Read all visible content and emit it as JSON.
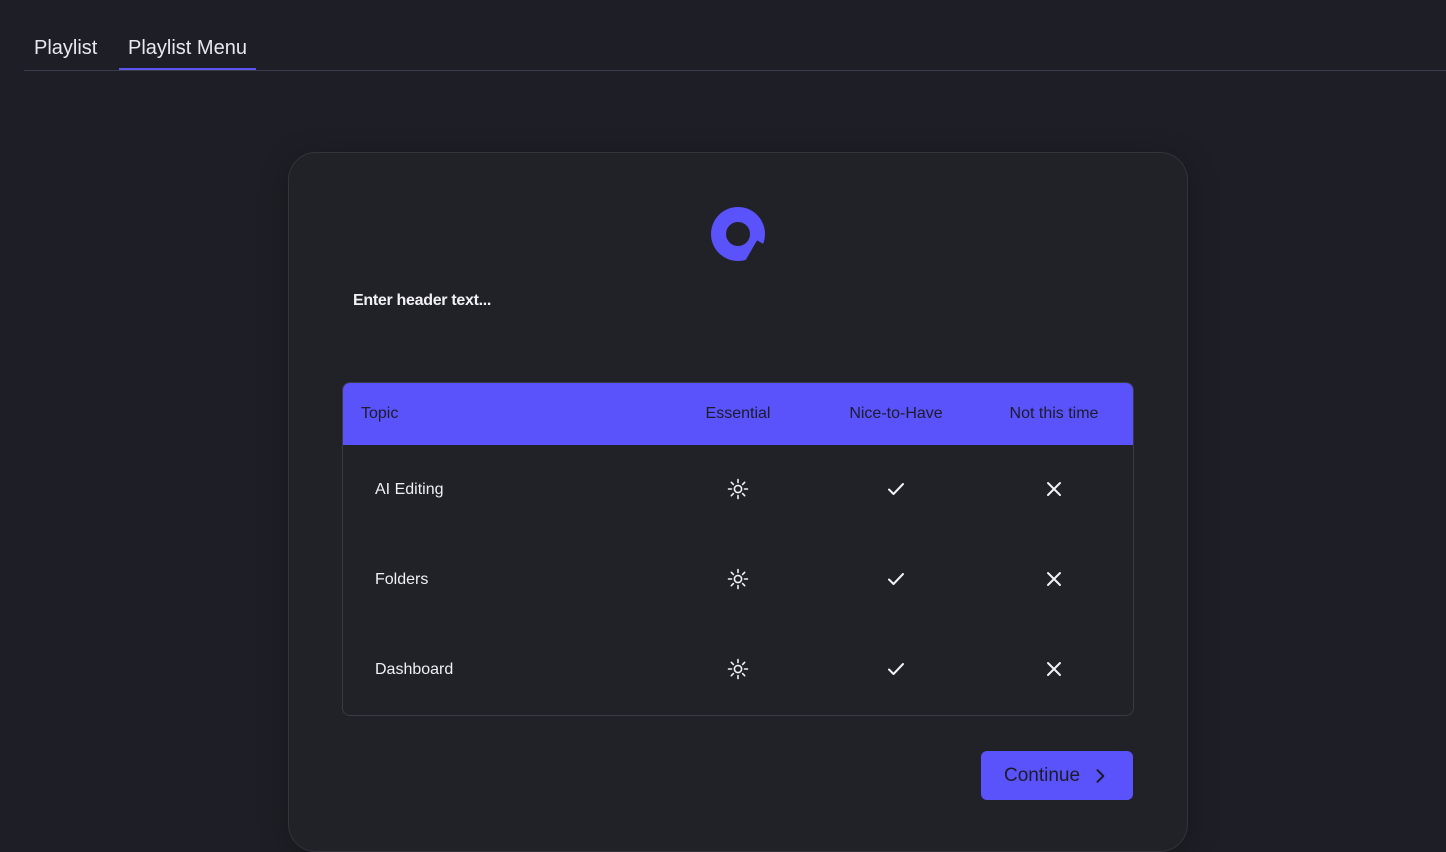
{
  "tabs": [
    {
      "label": "Playlist"
    },
    {
      "label": "Playlist Menu",
      "active": true
    }
  ],
  "card": {
    "header_text": "Enter header text...",
    "logo": "brand-ring-icon",
    "columns": [
      "Topic",
      "Essential",
      "Nice-to-Have",
      "Not this time"
    ],
    "rows": [
      {
        "topic": "AI Editing",
        "icons": [
          "sparkle-icon",
          "check-icon",
          "x-icon"
        ]
      },
      {
        "topic": "Folders",
        "icons": [
          "sparkle-icon",
          "check-icon",
          "x-icon"
        ]
      },
      {
        "topic": "Dashboard",
        "icons": [
          "sparkle-icon",
          "check-icon",
          "x-icon"
        ]
      }
    ],
    "continue_label": "Continue"
  },
  "colors": {
    "background": "#1e1e26",
    "card": "#212128",
    "accent": "#5a52fb",
    "text": "#ececf2"
  }
}
